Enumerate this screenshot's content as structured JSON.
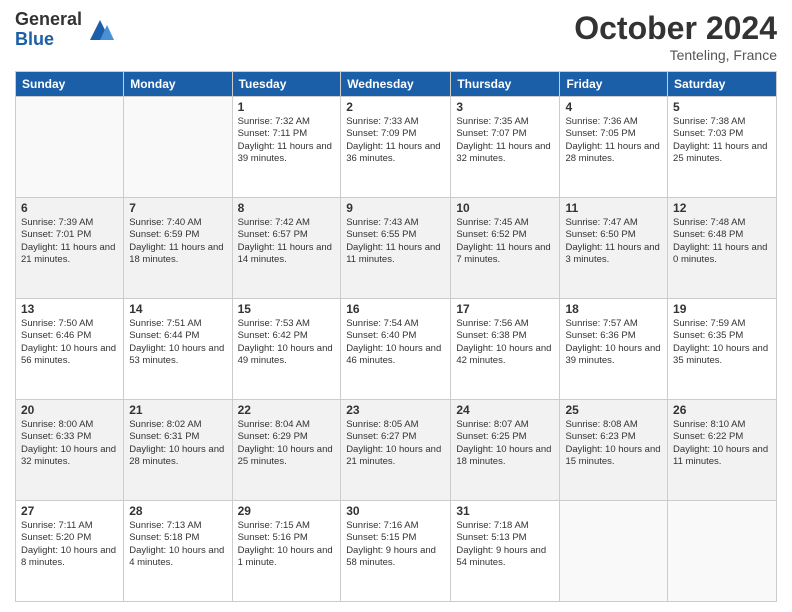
{
  "header": {
    "logo_general": "General",
    "logo_blue": "Blue",
    "month_title": "October 2024",
    "location": "Tenteling, France"
  },
  "days_of_week": [
    "Sunday",
    "Monday",
    "Tuesday",
    "Wednesday",
    "Thursday",
    "Friday",
    "Saturday"
  ],
  "weeks": [
    [
      {
        "day": "",
        "sunrise": "",
        "sunset": "",
        "daylight": "",
        "empty": true
      },
      {
        "day": "",
        "sunrise": "",
        "sunset": "",
        "daylight": "",
        "empty": true
      },
      {
        "day": "1",
        "sunrise": "Sunrise: 7:32 AM",
        "sunset": "Sunset: 7:11 PM",
        "daylight": "Daylight: 11 hours and 39 minutes."
      },
      {
        "day": "2",
        "sunrise": "Sunrise: 7:33 AM",
        "sunset": "Sunset: 7:09 PM",
        "daylight": "Daylight: 11 hours and 36 minutes."
      },
      {
        "day": "3",
        "sunrise": "Sunrise: 7:35 AM",
        "sunset": "Sunset: 7:07 PM",
        "daylight": "Daylight: 11 hours and 32 minutes."
      },
      {
        "day": "4",
        "sunrise": "Sunrise: 7:36 AM",
        "sunset": "Sunset: 7:05 PM",
        "daylight": "Daylight: 11 hours and 28 minutes."
      },
      {
        "day": "5",
        "sunrise": "Sunrise: 7:38 AM",
        "sunset": "Sunset: 7:03 PM",
        "daylight": "Daylight: 11 hours and 25 minutes."
      }
    ],
    [
      {
        "day": "6",
        "sunrise": "Sunrise: 7:39 AM",
        "sunset": "Sunset: 7:01 PM",
        "daylight": "Daylight: 11 hours and 21 minutes."
      },
      {
        "day": "7",
        "sunrise": "Sunrise: 7:40 AM",
        "sunset": "Sunset: 6:59 PM",
        "daylight": "Daylight: 11 hours and 18 minutes."
      },
      {
        "day": "8",
        "sunrise": "Sunrise: 7:42 AM",
        "sunset": "Sunset: 6:57 PM",
        "daylight": "Daylight: 11 hours and 14 minutes."
      },
      {
        "day": "9",
        "sunrise": "Sunrise: 7:43 AM",
        "sunset": "Sunset: 6:55 PM",
        "daylight": "Daylight: 11 hours and 11 minutes."
      },
      {
        "day": "10",
        "sunrise": "Sunrise: 7:45 AM",
        "sunset": "Sunset: 6:52 PM",
        "daylight": "Daylight: 11 hours and 7 minutes."
      },
      {
        "day": "11",
        "sunrise": "Sunrise: 7:47 AM",
        "sunset": "Sunset: 6:50 PM",
        "daylight": "Daylight: 11 hours and 3 minutes."
      },
      {
        "day": "12",
        "sunrise": "Sunrise: 7:48 AM",
        "sunset": "Sunset: 6:48 PM",
        "daylight": "Daylight: 11 hours and 0 minutes."
      }
    ],
    [
      {
        "day": "13",
        "sunrise": "Sunrise: 7:50 AM",
        "sunset": "Sunset: 6:46 PM",
        "daylight": "Daylight: 10 hours and 56 minutes."
      },
      {
        "day": "14",
        "sunrise": "Sunrise: 7:51 AM",
        "sunset": "Sunset: 6:44 PM",
        "daylight": "Daylight: 10 hours and 53 minutes."
      },
      {
        "day": "15",
        "sunrise": "Sunrise: 7:53 AM",
        "sunset": "Sunset: 6:42 PM",
        "daylight": "Daylight: 10 hours and 49 minutes."
      },
      {
        "day": "16",
        "sunrise": "Sunrise: 7:54 AM",
        "sunset": "Sunset: 6:40 PM",
        "daylight": "Daylight: 10 hours and 46 minutes."
      },
      {
        "day": "17",
        "sunrise": "Sunrise: 7:56 AM",
        "sunset": "Sunset: 6:38 PM",
        "daylight": "Daylight: 10 hours and 42 minutes."
      },
      {
        "day": "18",
        "sunrise": "Sunrise: 7:57 AM",
        "sunset": "Sunset: 6:36 PM",
        "daylight": "Daylight: 10 hours and 39 minutes."
      },
      {
        "day": "19",
        "sunrise": "Sunrise: 7:59 AM",
        "sunset": "Sunset: 6:35 PM",
        "daylight": "Daylight: 10 hours and 35 minutes."
      }
    ],
    [
      {
        "day": "20",
        "sunrise": "Sunrise: 8:00 AM",
        "sunset": "Sunset: 6:33 PM",
        "daylight": "Daylight: 10 hours and 32 minutes."
      },
      {
        "day": "21",
        "sunrise": "Sunrise: 8:02 AM",
        "sunset": "Sunset: 6:31 PM",
        "daylight": "Daylight: 10 hours and 28 minutes."
      },
      {
        "day": "22",
        "sunrise": "Sunrise: 8:04 AM",
        "sunset": "Sunset: 6:29 PM",
        "daylight": "Daylight: 10 hours and 25 minutes."
      },
      {
        "day": "23",
        "sunrise": "Sunrise: 8:05 AM",
        "sunset": "Sunset: 6:27 PM",
        "daylight": "Daylight: 10 hours and 21 minutes."
      },
      {
        "day": "24",
        "sunrise": "Sunrise: 8:07 AM",
        "sunset": "Sunset: 6:25 PM",
        "daylight": "Daylight: 10 hours and 18 minutes."
      },
      {
        "day": "25",
        "sunrise": "Sunrise: 8:08 AM",
        "sunset": "Sunset: 6:23 PM",
        "daylight": "Daylight: 10 hours and 15 minutes."
      },
      {
        "day": "26",
        "sunrise": "Sunrise: 8:10 AM",
        "sunset": "Sunset: 6:22 PM",
        "daylight": "Daylight: 10 hours and 11 minutes."
      }
    ],
    [
      {
        "day": "27",
        "sunrise": "Sunrise: 7:11 AM",
        "sunset": "Sunset: 5:20 PM",
        "daylight": "Daylight: 10 hours and 8 minutes."
      },
      {
        "day": "28",
        "sunrise": "Sunrise: 7:13 AM",
        "sunset": "Sunset: 5:18 PM",
        "daylight": "Daylight: 10 hours and 4 minutes."
      },
      {
        "day": "29",
        "sunrise": "Sunrise: 7:15 AM",
        "sunset": "Sunset: 5:16 PM",
        "daylight": "Daylight: 10 hours and 1 minute."
      },
      {
        "day": "30",
        "sunrise": "Sunrise: 7:16 AM",
        "sunset": "Sunset: 5:15 PM",
        "daylight": "Daylight: 9 hours and 58 minutes."
      },
      {
        "day": "31",
        "sunrise": "Sunrise: 7:18 AM",
        "sunset": "Sunset: 5:13 PM",
        "daylight": "Daylight: 9 hours and 54 minutes."
      },
      {
        "day": "",
        "sunrise": "",
        "sunset": "",
        "daylight": "",
        "empty": true
      },
      {
        "day": "",
        "sunrise": "",
        "sunset": "",
        "daylight": "",
        "empty": true
      }
    ]
  ]
}
